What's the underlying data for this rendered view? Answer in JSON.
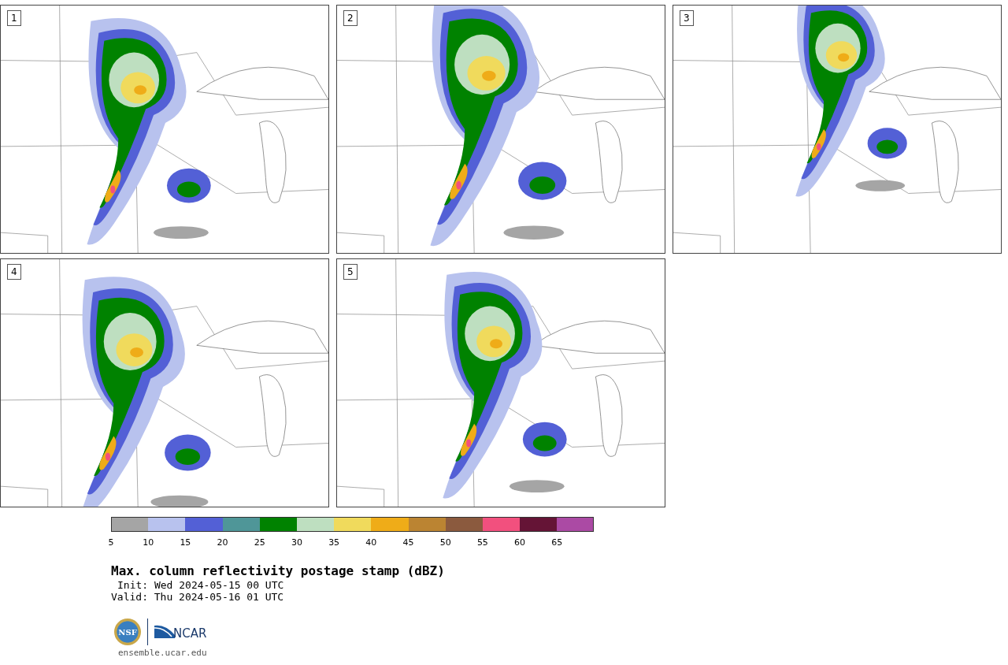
{
  "panels": [
    {
      "label": "1"
    },
    {
      "label": "2"
    },
    {
      "label": "3"
    },
    {
      "label": "4"
    },
    {
      "label": "5"
    }
  ],
  "colorbar": {
    "bins": [
      {
        "color": "#a5a5a5"
      },
      {
        "color": "#b8c2ee"
      },
      {
        "color": "#5360d6"
      },
      {
        "color": "#4f9698"
      },
      {
        "color": "#008200"
      },
      {
        "color": "#bedfc0"
      },
      {
        "color": "#f0da5c"
      },
      {
        "color": "#efac18"
      },
      {
        "color": "#bb8432"
      },
      {
        "color": "#8b5a3e"
      },
      {
        "color": "#f2507e"
      },
      {
        "color": "#651436"
      },
      {
        "color": "#ab4aa4"
      }
    ],
    "ticks": [
      "5",
      "10",
      "15",
      "20",
      "25",
      "30",
      "35",
      "40",
      "45",
      "50",
      "55",
      "60",
      "65"
    ]
  },
  "title": "Max. column reflectivity postage stamp (dBZ)",
  "init": "Init: Wed 2024-05-15 00 UTC",
  "valid": "Valid: Thu 2024-05-16 01 UTC",
  "logos": {
    "seal_text": "NSF",
    "brand_text": "NCAR"
  },
  "site": "ensemble.ucar.edu"
}
